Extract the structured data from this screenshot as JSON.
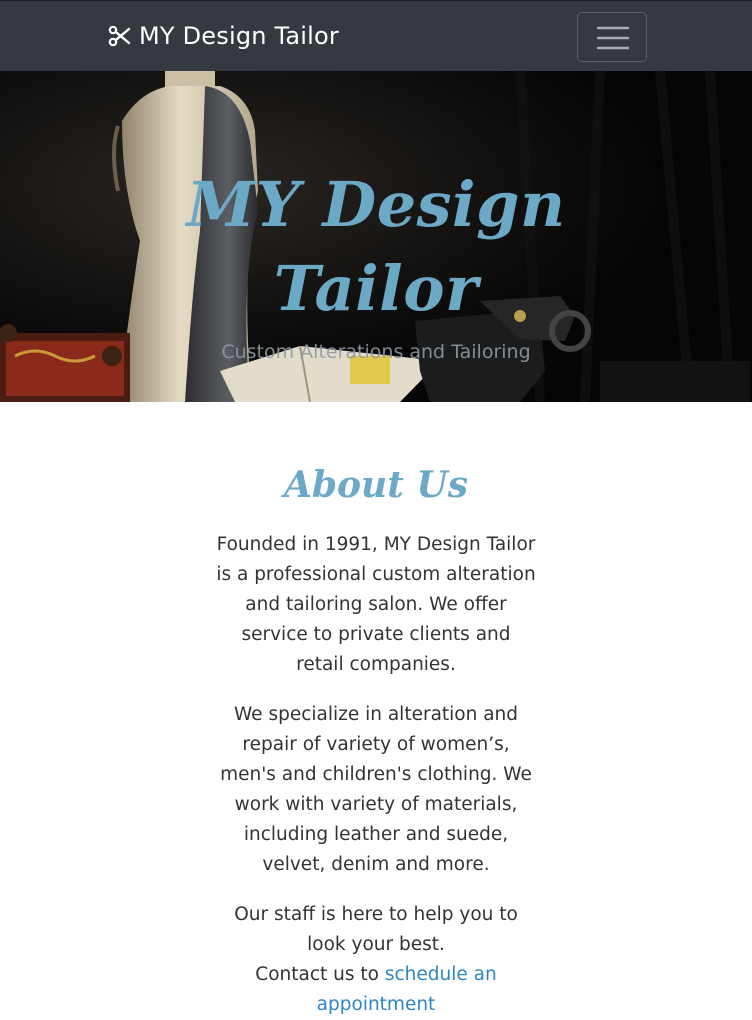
{
  "navbar": {
    "brand_text": "MY Design Tailor",
    "brand_icon": "scissors-icon",
    "toggler_icon": "hamburger-menu-icon",
    "background": "#343a40"
  },
  "hero": {
    "title_line1": "MY Design",
    "title_line2": "Tailor",
    "subtitle": "Custom Alterations and Tailoring",
    "title_color": "#6ba9c6"
  },
  "about": {
    "heading": "About Us",
    "paragraphs": [
      "Founded in 1991, MY Design Tailor is a professional custom alteration and tailoring salon. We offer service to private clients and retail companies.",
      "We specialize in alteration and repair of variety of women’s, men's and children's clothing. We work with variety of materials, including leather and suede, velvet, denim and more.",
      "Our staff is here to help you to look your best."
    ],
    "contact_prefix": "Contact us to",
    "contact_link": "schedule an appointment",
    "accent_color": "#6ba9c6",
    "text_color": "#333333"
  }
}
